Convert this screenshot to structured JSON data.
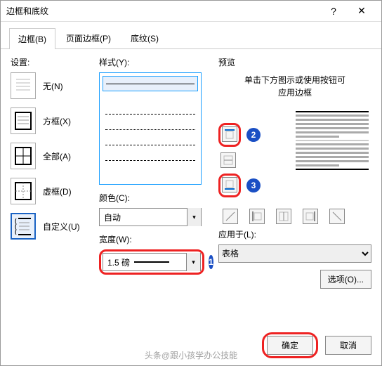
{
  "title": "边框和底纹",
  "help": "?",
  "close": "✕",
  "tabs": {
    "borders": "边框(B)",
    "page": "页面边框(P)",
    "shading": "底纹(S)"
  },
  "setting_label": "设置:",
  "settings": {
    "none": "无(N)",
    "box": "方框(X)",
    "all": "全部(A)",
    "grid": "虚框(D)",
    "custom": "自定义(U)"
  },
  "style_label": "样式(Y):",
  "color_label": "颜色(C):",
  "color_value": "自动",
  "width_label": "宽度(W):",
  "width_value": "1.5 磅",
  "preview_label": "预览",
  "preview_hint1": "单击下方图示或使用按钮可",
  "preview_hint2": "应用边框",
  "apply_label": "应用于(L):",
  "apply_value": "表格",
  "options_btn": "选项(O)...",
  "ok": "确定",
  "cancel": "取消",
  "badges": {
    "b1": "1",
    "b2": "2",
    "b3": "3"
  },
  "watermark": "头条@跟小孩学办公技能"
}
